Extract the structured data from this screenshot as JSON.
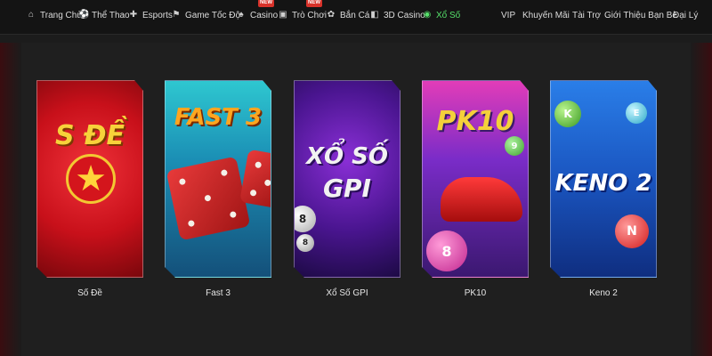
{
  "nav": {
    "items": [
      {
        "label": "Trang Chủ",
        "icon": "home-icon",
        "glyph": "⌂"
      },
      {
        "label": "Thể Thao",
        "icon": "soccer-ball-icon",
        "glyph": "⚽"
      },
      {
        "label": "Esports",
        "icon": "gamepad-icon",
        "glyph": "✚"
      },
      {
        "label": "Game Tốc Độ",
        "icon": "joystick-icon",
        "glyph": "⚑"
      },
      {
        "label": "Casino",
        "icon": "cards-icon",
        "glyph": "♠",
        "badge": "NEW"
      },
      {
        "label": "Trò Chơi",
        "icon": "slot-machine-icon",
        "glyph": "▣",
        "badge": "NEW"
      },
      {
        "label": "Bắn Cá",
        "icon": "fish-icon",
        "glyph": "✿"
      },
      {
        "label": "3D Casino",
        "icon": "3d-cube-icon",
        "glyph": "◧"
      },
      {
        "label": "Xổ Số",
        "icon": "lottery-icon",
        "glyph": "◉",
        "active": true
      }
    ],
    "right": [
      "VIP",
      "Khuyến Mãi",
      "Tài Trợ",
      "Giới Thiệu Bạn Bè",
      "Đại Lý"
    ]
  },
  "colors": {
    "active": "#55e06a",
    "badge": "#d8322a",
    "background": "#1c1c1c"
  },
  "games": [
    {
      "label": "Số Đề",
      "art_text": "S ĐỀ"
    },
    {
      "label": "Fast 3",
      "art_text": "FAST 3"
    },
    {
      "label": "Xổ Số GPI",
      "art_text_1": "XỔ SỐ",
      "art_text_2": "GPI"
    },
    {
      "label": "PK10",
      "art_text": "PK10"
    },
    {
      "label": "Keno 2",
      "art_text": "KENO 2"
    }
  ]
}
